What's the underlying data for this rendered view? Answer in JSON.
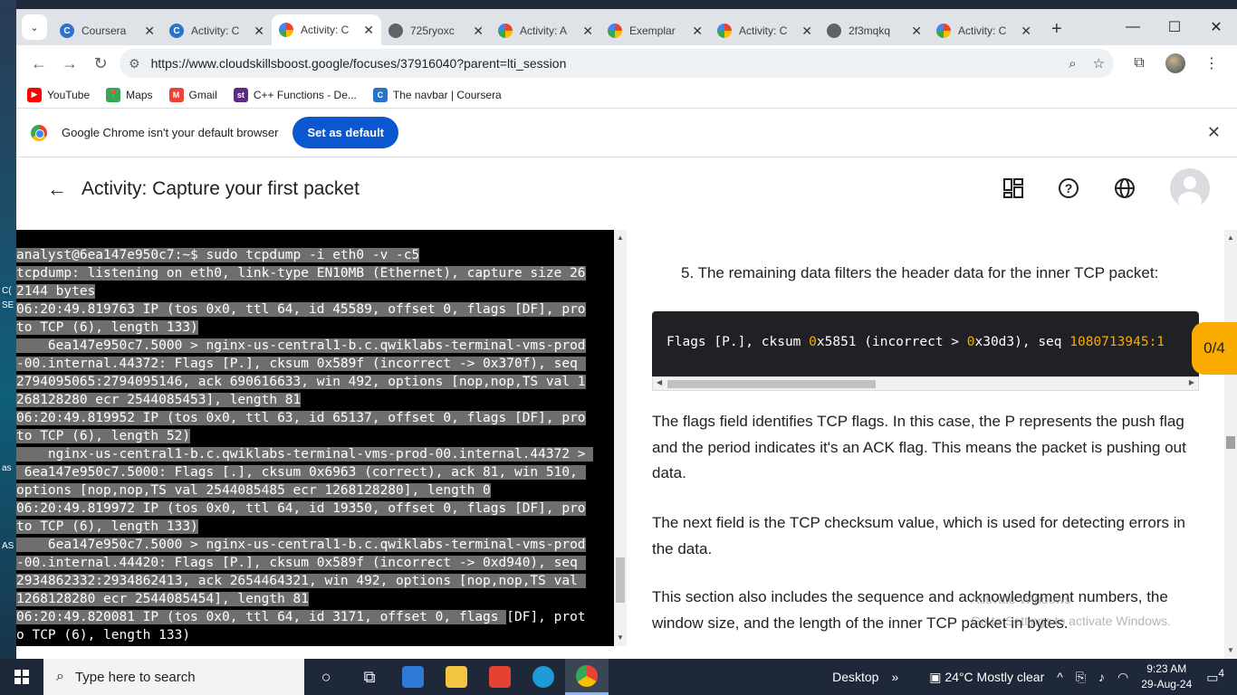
{
  "browser": {
    "tabs": [
      {
        "title": "Coursera",
        "favicon": "coursera",
        "active": false
      },
      {
        "title": "Activity: C",
        "favicon": "coursera",
        "active": false
      },
      {
        "title": "Activity: C",
        "favicon": "cloud",
        "active": true
      },
      {
        "title": "725ryoxc",
        "favicon": "globe",
        "active": false
      },
      {
        "title": "Activity: A",
        "favicon": "cloud",
        "active": false
      },
      {
        "title": "Exemplar",
        "favicon": "cloud",
        "active": false
      },
      {
        "title": "Activity: C",
        "favicon": "cloud",
        "active": false
      },
      {
        "title": "2f3mqkq",
        "favicon": "globe",
        "active": false
      },
      {
        "title": "Activity: C",
        "favicon": "cloud",
        "active": false
      }
    ],
    "url": "https://www.cloudskillsboost.google/focuses/37916040?parent=lti_session",
    "bookmarks": [
      {
        "label": "YouTube",
        "color": "#ff0000",
        "icon": "▶"
      },
      {
        "label": "Maps",
        "color": "#34a853",
        "icon": "📍"
      },
      {
        "label": "Gmail",
        "color": "#ea4335",
        "icon": "M"
      },
      {
        "label": "C++ Functions - De...",
        "color": "#5b2c83",
        "icon": "st"
      },
      {
        "label": "The navbar | Coursera",
        "color": "#2a73cc",
        "icon": "C"
      }
    ],
    "infobar": {
      "message": "Google Chrome isn't your default browser",
      "button": "Set as default"
    }
  },
  "page": {
    "title": "Activity: Capture your first packet"
  },
  "terminal": {
    "lines": [
      {
        "text": "analyst@6ea147e950c7:~$ sudo tcpdump -i eth0 -v -c5",
        "sel": ""
      },
      {
        "text": "tcpdump: listening on eth0, link-type EN10MB (Ethernet), capture size 26",
        "sel": ""
      },
      {
        "text": "2144 bytes",
        "sel": ""
      },
      {
        "text": "06:20:49.819763 IP (tos 0x0, ttl 64, id 45589, offset 0, flags [DF], pro",
        "sel": ""
      },
      {
        "text": "to TCP (6), length 133)",
        "sel": ""
      },
      {
        "text": "    6ea147e950c7.5000 > nginx-us-central1-b.c.qwiklabs-terminal-vms-prod",
        "sel": ""
      },
      {
        "text": "-00.internal.44372: Flags [P.], cksum 0x589f (incorrect -> 0x370f), seq ",
        "sel": ""
      },
      {
        "text": "2794095065:2794095146, ack 690616633, win 492, options [nop,nop,TS val 1",
        "sel": ""
      },
      {
        "text": "268128280 ecr 2544085453], length 81",
        "sel": ""
      },
      {
        "text": "06:20:49.819952 IP (tos 0x0, ttl 63, id 65137, offset 0, flags [DF], pro",
        "sel": ""
      },
      {
        "text": "to TCP (6), length 52)",
        "sel": ""
      },
      {
        "text": "    nginx-us-central1-b.c.qwiklabs-terminal-vms-prod-00.internal.44372 > ",
        "sel": ""
      },
      {
        "text": " 6ea147e950c7.5000: Flags [.], cksum 0x6963 (correct), ack 81, win 510, ",
        "sel": ""
      },
      {
        "text": "options [nop,nop,TS val 2544085485 ecr 1268128280], length 0",
        "sel": ""
      },
      {
        "text": "06:20:49.819972 IP (tos 0x0, ttl 64, id 19350, offset 0, flags [DF], pro",
        "sel": ""
      },
      {
        "text": "to TCP (6), length 133)",
        "sel": ""
      },
      {
        "text": "    6ea147e950c7.5000 > nginx-us-central1-b.c.qwiklabs-terminal-vms-prod",
        "sel": ""
      },
      {
        "text": "-00.internal.44420: Flags [P.], cksum 0x589f (incorrect -> 0xd940), seq ",
        "sel": ""
      },
      {
        "text": "2934862332:2934862413, ack 2654464321, win 492, options [nop,nop,TS val ",
        "sel": ""
      },
      {
        "text": "1268128280 ecr 2544085454], length 81",
        "sel": ""
      },
      {
        "text": "06:20:49.820081 IP (tos 0x0, ttl 64, id 3171, offset 0, flags ",
        "sel": "[DF], prot"
      },
      {
        "text": "o TCP (6), length 133)",
        "sel": "none"
      }
    ]
  },
  "instructions": {
    "step": "5. The remaining data filters the header data for the inner TCP packet:",
    "code_prefix": "Flags [P.], cksum ",
    "code_n1": "0",
    "code_mid1": "x5851 (incorrect > ",
    "code_n2": "0",
    "code_mid2": "x30d3), seq ",
    "code_n3": "1080713945",
    "code_tail": ":1",
    "para1": "The flags field identifies TCP flags. In this case, the P represents the push flag and the period indicates it's an ACK flag. This means the packet is pushing out data.",
    "para2": "The next field is the TCP checksum value, which is used for detecting errors in the data.",
    "para3": "This section also includes the sequence and acknowledgment numbers, the window size, and the length of the inner TCP packet in bytes.",
    "watermark_line1": "Activate Windows",
    "watermark_line2": "Go to Settings to activate Windows."
  },
  "progress_badge": "0/4",
  "taskbar": {
    "search_placeholder": "Type here to search",
    "desktop_label": "Desktop",
    "weather": "24°C  Mostly clear",
    "time": "9:23 AM",
    "date": "29-Aug-24",
    "notification_count": "4"
  }
}
